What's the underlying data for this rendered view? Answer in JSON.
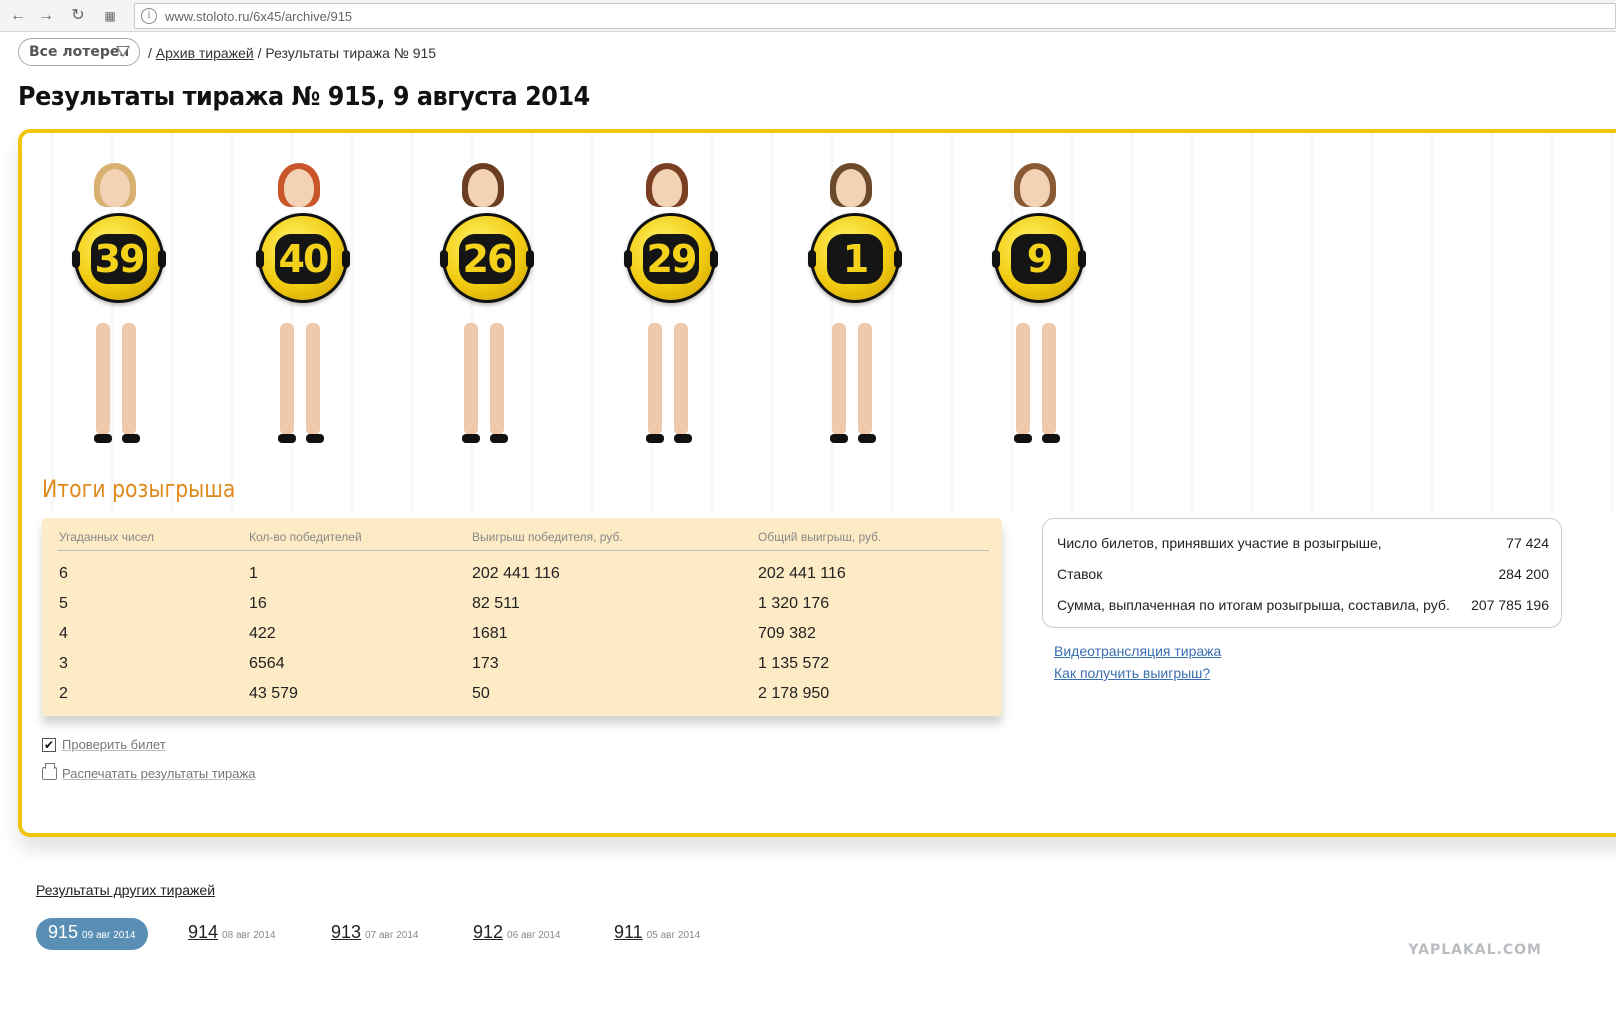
{
  "browser": {
    "url": "www.stoloto.ru/6x45/archive/915"
  },
  "breadcrumb": {
    "lottery_select": "Все лотереи",
    "separator": "/",
    "archive_link": "Архив тиражей",
    "current": "Результаты тиража № 915"
  },
  "page_title": "Результаты тиража № 915, 9 августа 2014",
  "balls": [
    "39",
    "40",
    "26",
    "29",
    "1",
    "9"
  ],
  "results": {
    "title": "Итоги розыгрыша",
    "headers": [
      "Угаданных чисел",
      "Кол-во победителей",
      "Выигрыш победителя, руб.",
      "Общий выигрыш, руб."
    ],
    "rows": [
      [
        "6",
        "1",
        "202 441 116",
        "202 441 116"
      ],
      [
        "5",
        "16",
        "82 511",
        "1 320 176"
      ],
      [
        "4",
        "422",
        "1681",
        "709 382"
      ],
      [
        "3",
        "6564",
        "173",
        "1 135 572"
      ],
      [
        "2",
        "43 579",
        "50",
        "2 178 950"
      ]
    ]
  },
  "stats": {
    "tickets_label": "Число билетов, принявших участие в розыгрыше,",
    "tickets_value": "77 424",
    "bets_label": "Ставок",
    "bets_value": "284 200",
    "paid_label": "Сумма, выплаченная по итогам розыгрыша, составила, руб.",
    "paid_value": "207 785 196"
  },
  "links": {
    "video": "Видеотрансляция тиража",
    "how_to_get": "Как получить выигрыш?"
  },
  "actions": {
    "check_ticket": "Проверить билет",
    "print_results": "Распечатать результаты тиража"
  },
  "other_draws": {
    "title": "Результаты других тиражей",
    "items": [
      {
        "num": "915",
        "date": "09 авг 2014"
      },
      {
        "num": "914",
        "date": "08 авг 2014"
      },
      {
        "num": "913",
        "date": "07 авг 2014"
      },
      {
        "num": "912",
        "date": "06 авг 2014"
      },
      {
        "num": "911",
        "date": "05 авг 2014"
      }
    ]
  },
  "watermark": "YAPLAKAL.COM",
  "colors": {
    "card_border": "#f1c40f",
    "results_title": "#e08a1e",
    "table_bg": "#fdebc5",
    "link": "#3a6fb0",
    "active_draw": "#5a8fb5"
  }
}
